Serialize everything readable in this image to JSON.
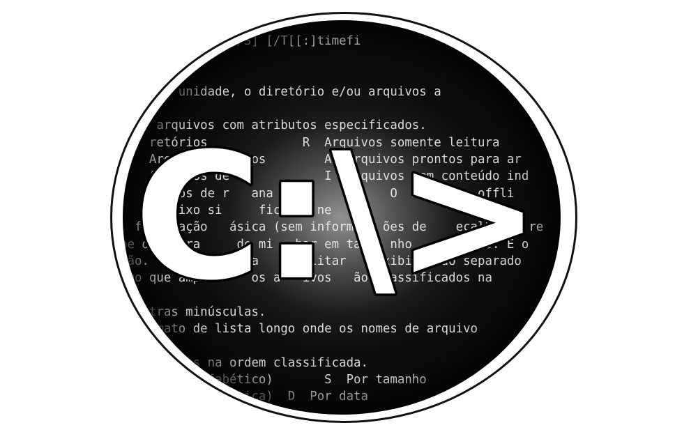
{
  "terminal": {
    "lines": [
      "             ] [/S] [/T[[:]timefi",
      "",
      "",
      "      a unidade, o diretório e/ou arquivos a",
      "",
      "     arquivos com atributos especificados.",
      "    retórios             R  Arquivos somente leitura",
      "    Arquivos ocultos        A  Arquivos prontos para ar",
      "    Arquivos de             I  Arquivos sem conteúdo ind",
      "    Pontos de r   ana    e           O  Arquivos offli",
      "    Prefixo si     ficando ne   ão",
      "  formatação   ásica (sem informa   ões de    eçalho ou re",
      "be o separa     de mi   har em ta    nho   arquivos. É o",
      "rão.  Use /-    ara   sabilitar    exibição do separado",
      "smo que ampl      os a   ivos   ão classificados na",
      "",
      "    tras minúsculas.",
      "    rmato de lista longo onde os nomes de arquivo",
      "",
      "    rquivos na ordem classificada.",
      "         (alfabético)       S  Por tamanho",
      "         (alfabética)  D  Por data",
      "                   ",
      ""
    ]
  },
  "logo": {
    "text": "C:\\>",
    "icon": "command-prompt-icon"
  },
  "colors": {
    "page_background": "#ffffff",
    "terminal_background": "#0c0c0c",
    "terminal_text": "#d8d8d8",
    "logo_fill": "#ffffff",
    "logo_outline": "#000000"
  }
}
